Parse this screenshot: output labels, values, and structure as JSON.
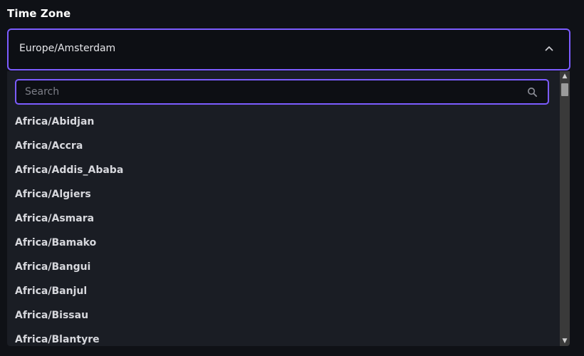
{
  "field": {
    "label": "Time Zone"
  },
  "select": {
    "value": "Europe/Amsterdam",
    "state_icon": "chevron-up-icon"
  },
  "search": {
    "placeholder": "Search",
    "value": "",
    "icon": "search-icon"
  },
  "options": [
    "Africa/Abidjan",
    "Africa/Accra",
    "Africa/Addis_Ababa",
    "Africa/Algiers",
    "Africa/Asmara",
    "Africa/Bamako",
    "Africa/Bangui",
    "Africa/Banjul",
    "Africa/Bissau",
    "Africa/Blantyre"
  ],
  "scrollbar": {
    "up_arrow": "▲",
    "down_arrow": "▼"
  },
  "colors": {
    "accent": "#7c5cff",
    "background": "#0f1116",
    "dropdown_background": "#1a1d24",
    "text": "#d7d8dd"
  }
}
